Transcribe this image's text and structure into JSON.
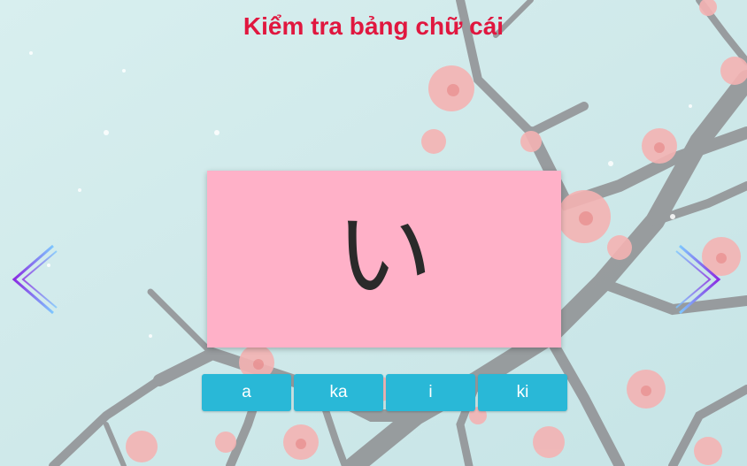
{
  "page": {
    "title": "Kiểm tra bảng chữ cái"
  },
  "card": {
    "character": "い"
  },
  "answers": [
    {
      "label": "a"
    },
    {
      "label": "ka"
    },
    {
      "label": "i"
    },
    {
      "label": "ki"
    }
  ],
  "nav": {
    "prev_icon": "chevron-left-icon",
    "next_icon": "chevron-right-icon"
  },
  "colors": {
    "title": "#e0173f",
    "card": "#ffb1c8",
    "button": "#29b8d7",
    "button_text": "#ffffff",
    "chevron_start": "#8b2be2",
    "chevron_end": "#7ec8ff"
  }
}
